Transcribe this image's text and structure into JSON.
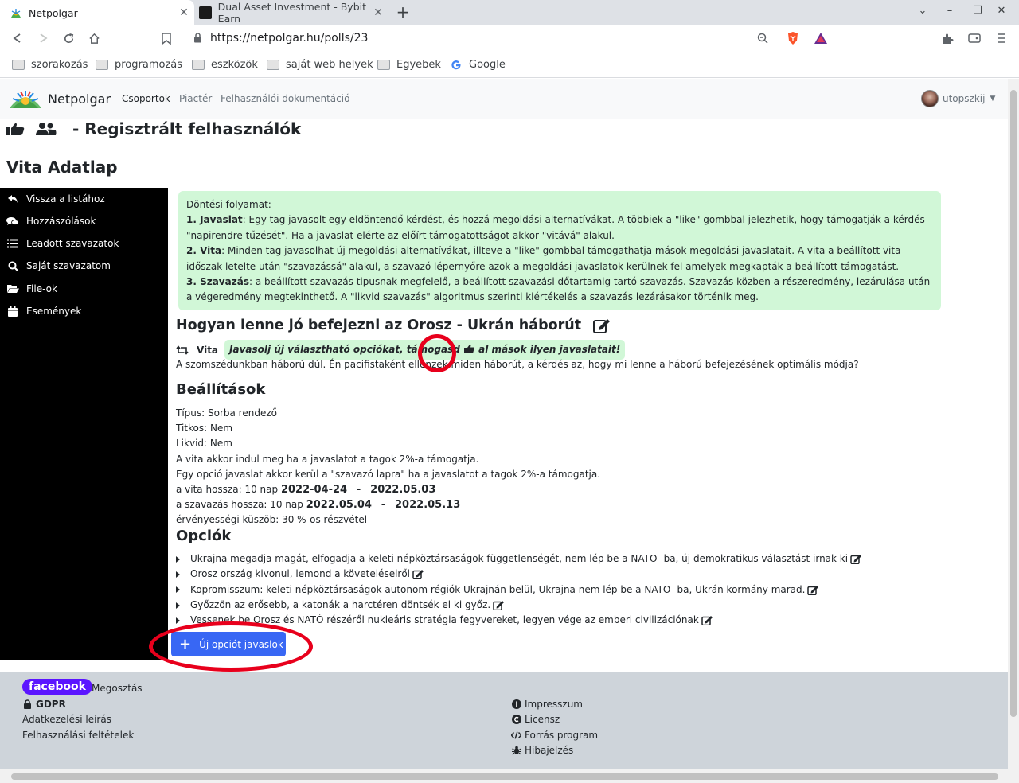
{
  "browser": {
    "tabs": [
      {
        "title": "Netpolgar",
        "active": true
      },
      {
        "title": "Dual Asset Investment - Bybit Earn",
        "active": false
      }
    ],
    "url": "https://netpolgar.hu/polls/23",
    "bookmarks": [
      "szorakozás",
      "programozás",
      "eszközök",
      "saját web helyek",
      "Egyebek",
      "Google"
    ]
  },
  "navbar": {
    "brand": "Netpolgar",
    "links": [
      "Csoportok",
      "Piactér",
      "Felhasználói dokumentáció"
    ],
    "user": "utopszkij"
  },
  "page": {
    "group_title": "- Regisztrált felhasználók",
    "title": "Vita Adatlap"
  },
  "sidebar": {
    "items": [
      {
        "label": "Vissza a listához",
        "icon": "reply-icon"
      },
      {
        "label": "Hozzászólások",
        "icon": "comments-icon"
      },
      {
        "label": "Leadott szavazatok",
        "icon": "list-icon"
      },
      {
        "label": "Saját szavazatom",
        "icon": "search-icon"
      },
      {
        "label": "File-ok",
        "icon": "folder-open-icon"
      },
      {
        "label": "Események",
        "icon": "calendar-icon"
      }
    ]
  },
  "process": {
    "heading": "Döntési folyamat:",
    "step1_title": "1. Javaslat",
    "step1_text": ": Egy tag javasolt egy eldöntendő kérdést, és hozzá megoldási alternatívákat. A többiek a \"like\" gombbal jelezhetik, hogy támogatják a kérdés \"napirendre tűzését\". Ha a javaslat elérte az előírt támogatottságot akkor \"vitává\" alakul.",
    "step2_title": "2. Vita",
    "step2_text": ": Minden tag javasolhat új megoldási alternatívákat, illteve a \"like\" gombbal támogathatja mások megoldási javaslatait. A vita a beállított vita időszak letelte után \"szavazássá\" alakul, a szavazó lépernyőre azok a megoldási javaslatok kerülnek fel amelyek megkapták a beállított támogatást.",
    "step3_title": "3. Szavazás",
    "step3_text": ": a beállított szavazás tipusnak megfelelő, a beállított szavazási dőtartamig tartó szavazás. Szavazás közben a részeredmény, lezárulása után a végeredmény megtekinthető. A \"likvid szavazás\" algoritmus szerinti kiértékelés a szavazás lezárásakor történik meg."
  },
  "poll": {
    "question": "Hogyan lenne jó befejezni az Orosz - Ukrán háborút",
    "status": "Vita",
    "badge_before": "Javasolj új választható opciókat, támogasd",
    "badge_after": "al mások ilyen javaslatait!",
    "description_before": "A szomszédunkban háború dúl. Én pacifistaként ellenzek mi",
    "description_after": "den háborút, a kérdés az, hogy mi lenne a háború befejezésének optimális módja?"
  },
  "settings": {
    "heading": "Beállítások",
    "type": "Típus: Sorba rendező",
    "secret": "Titkos: Nem",
    "liquid": "Likvid: Nem",
    "debate_start": "A vita akkor indul meg ha a javaslatot a tagok 2%-a támogatja.",
    "option_rule": "Egy opció javaslat akkor kerül a \"szavazó lapra\" ha a javaslatot a tagok 2%-a támogatja.",
    "debate_length": "a vita hossza: 10 nap",
    "debate_from": "2022-04-24",
    "debate_to": "2022.05.03",
    "vote_length": "a szavazás hossza: 10 nap",
    "vote_from": "2022.05.04",
    "vote_to": "2022.05.13",
    "separator": "-",
    "quorum": "érvényességi küszöb: 30 %-os részvétel"
  },
  "options": {
    "heading": "Opciók",
    "items": [
      "Ukrajna megadja magát, elfogadja a keleti népköztársaságok függetlenségét, nem lép be a NATO -ba, új demokratikus választást irnak ki",
      "Orosz ország kivonul, lemond a követeléseiről",
      "Kopromisszum: keleti népköztársaságok autonom régiók Ukrajnán belül, Ukrajna nem lép be a NATO -ba, Ukrán kormány marad.",
      "Győzzön az erősebb, a katonák a harctéren döntsék el ki győz.",
      "Vessenek be Orosz és NATÓ részéről nukleáris stratégia fegyvereket, legyen vége az emberi civilizációnak"
    ],
    "new_button": "Új opciót javaslok"
  },
  "footer": {
    "facebook": "facebook",
    "share": "Megosztás",
    "gdpr": "GDPR",
    "privacy": "Adatkezelési leírás",
    "terms": "Felhasználási feltételek",
    "impressum": "Impresszum",
    "license": "Licensz",
    "source": "Forrás program",
    "bug": "Hibajelzés"
  },
  "colors": {
    "accent": "#3867f4",
    "alert_bg": "#d1f7d7",
    "sidebar_bg": "#000000",
    "footer_bg": "#ced4da",
    "annotation": "#e8001c",
    "facebook": "#5b15ff"
  }
}
